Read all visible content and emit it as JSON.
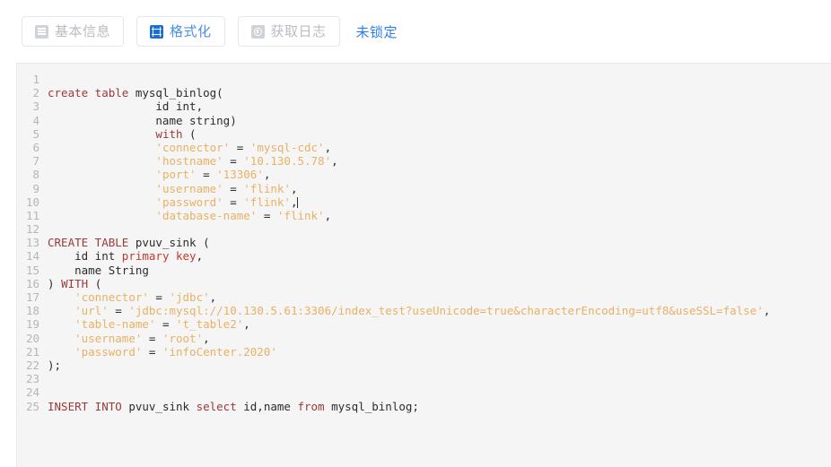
{
  "toolbar": {
    "buttons": [
      {
        "label": "基本信息",
        "icon": "document-icon",
        "state": "inactive"
      },
      {
        "label": "格式化",
        "icon": "grid-table-icon",
        "state": "active"
      },
      {
        "label": "获取日志",
        "icon": "log-clock-icon",
        "state": "inactive"
      }
    ],
    "lock_link": "未锁定"
  },
  "colors": {
    "accent_blue": "#2a7ef0",
    "active_text": "#4a90e8",
    "inactive_text": "#b9bcc2",
    "editor_bg": "#f5f5f5",
    "line_number": "#b6b6b6",
    "keyword": "#9b3a38",
    "keyword_alt": "#c0392b",
    "string": "#e8b164",
    "plain": "#2b2b2b"
  },
  "editor": {
    "language": "sql",
    "line_count": 25,
    "caret_line": 10,
    "lines": [
      {
        "n": "1",
        "tokens": []
      },
      {
        "n": "2",
        "tokens": [
          {
            "t": "create table ",
            "c": "kw"
          },
          {
            "t": "mysql_binlog(",
            "c": "pln"
          }
        ]
      },
      {
        "n": "3",
        "tokens": [
          {
            "t": "                id int,",
            "c": "pln"
          }
        ]
      },
      {
        "n": "4",
        "tokens": [
          {
            "t": "                name string)",
            "c": "pln"
          }
        ]
      },
      {
        "n": "5",
        "tokens": [
          {
            "t": "                ",
            "c": "pln"
          },
          {
            "t": "with",
            "c": "kw"
          },
          {
            "t": " (",
            "c": "pln"
          }
        ]
      },
      {
        "n": "6",
        "tokens": [
          {
            "t": "                ",
            "c": "pln"
          },
          {
            "t": "'connector'",
            "c": "str"
          },
          {
            "t": " = ",
            "c": "pln"
          },
          {
            "t": "'mysql-cdc'",
            "c": "str"
          },
          {
            "t": ",",
            "c": "pln"
          }
        ]
      },
      {
        "n": "7",
        "tokens": [
          {
            "t": "                ",
            "c": "pln"
          },
          {
            "t": "'hostname'",
            "c": "str"
          },
          {
            "t": " = ",
            "c": "pln"
          },
          {
            "t": "'10.130.5.78'",
            "c": "str"
          },
          {
            "t": ",",
            "c": "pln"
          }
        ]
      },
      {
        "n": "8",
        "tokens": [
          {
            "t": "                ",
            "c": "pln"
          },
          {
            "t": "'port'",
            "c": "str"
          },
          {
            "t": " = ",
            "c": "pln"
          },
          {
            "t": "'13306'",
            "c": "str"
          },
          {
            "t": ",",
            "c": "pln"
          }
        ]
      },
      {
        "n": "9",
        "tokens": [
          {
            "t": "                ",
            "c": "pln"
          },
          {
            "t": "'username'",
            "c": "str"
          },
          {
            "t": " = ",
            "c": "pln"
          },
          {
            "t": "'flink'",
            "c": "str"
          },
          {
            "t": ",",
            "c": "pln"
          }
        ]
      },
      {
        "n": "10",
        "tokens": [
          {
            "t": "                ",
            "c": "pln"
          },
          {
            "t": "'password'",
            "c": "str"
          },
          {
            "t": " = ",
            "c": "pln"
          },
          {
            "t": "'flink'",
            "c": "str"
          },
          {
            "t": ",",
            "c": "pln"
          }
        ],
        "caret": true
      },
      {
        "n": "11",
        "tokens": [
          {
            "t": "                ",
            "c": "pln"
          },
          {
            "t": "'database-name'",
            "c": "str"
          },
          {
            "t": " = ",
            "c": "pln"
          },
          {
            "t": "'flink'",
            "c": "str"
          },
          {
            "t": ",",
            "c": "pln"
          }
        ]
      },
      {
        "n": "12",
        "tokens": []
      },
      {
        "n": "13",
        "tokens": [
          {
            "t": "CREATE TABLE ",
            "c": "kw"
          },
          {
            "t": "pvuv_sink (",
            "c": "pln"
          }
        ]
      },
      {
        "n": "14",
        "tokens": [
          {
            "t": "    id int ",
            "c": "pln"
          },
          {
            "t": "primary key",
            "c": "kw2"
          },
          {
            "t": ",",
            "c": "pln"
          }
        ]
      },
      {
        "n": "15",
        "tokens": [
          {
            "t": "    name String",
            "c": "pln"
          }
        ]
      },
      {
        "n": "16",
        "tokens": [
          {
            "t": ") ",
            "c": "pln"
          },
          {
            "t": "WITH",
            "c": "kw"
          },
          {
            "t": " (",
            "c": "pln"
          }
        ]
      },
      {
        "n": "17",
        "tokens": [
          {
            "t": "    ",
            "c": "pln"
          },
          {
            "t": "'connector'",
            "c": "str"
          },
          {
            "t": " = ",
            "c": "pln"
          },
          {
            "t": "'jdbc'",
            "c": "str"
          },
          {
            "t": ",",
            "c": "pln"
          }
        ]
      },
      {
        "n": "18",
        "tokens": [
          {
            "t": "    ",
            "c": "pln"
          },
          {
            "t": "'url'",
            "c": "str"
          },
          {
            "t": " = ",
            "c": "pln"
          },
          {
            "t": "'jdbc:mysql://10.130.5.61:3306/index_test?useUnicode=true&characterEncoding=utf8&useSSL=false'",
            "c": "str"
          },
          {
            "t": ",",
            "c": "pln"
          }
        ]
      },
      {
        "n": "19",
        "tokens": [
          {
            "t": "    ",
            "c": "pln"
          },
          {
            "t": "'table-name'",
            "c": "str"
          },
          {
            "t": " = ",
            "c": "pln"
          },
          {
            "t": "'t_table2'",
            "c": "str"
          },
          {
            "t": ",",
            "c": "pln"
          }
        ]
      },
      {
        "n": "20",
        "tokens": [
          {
            "t": "    ",
            "c": "pln"
          },
          {
            "t": "'username'",
            "c": "str"
          },
          {
            "t": " = ",
            "c": "pln"
          },
          {
            "t": "'root'",
            "c": "str"
          },
          {
            "t": ",",
            "c": "pln"
          }
        ]
      },
      {
        "n": "21",
        "tokens": [
          {
            "t": "    ",
            "c": "pln"
          },
          {
            "t": "'password'",
            "c": "str"
          },
          {
            "t": " = ",
            "c": "pln"
          },
          {
            "t": "'infoCenter.2020'",
            "c": "str"
          }
        ]
      },
      {
        "n": "22",
        "tokens": [
          {
            "t": ");",
            "c": "pln"
          }
        ]
      },
      {
        "n": "23",
        "tokens": []
      },
      {
        "n": "24",
        "tokens": []
      },
      {
        "n": "25",
        "tokens": [
          {
            "t": "INSERT INTO ",
            "c": "kw"
          },
          {
            "t": "pvuv_sink ",
            "c": "pln"
          },
          {
            "t": "select",
            "c": "kw"
          },
          {
            "t": " id,name ",
            "c": "pln"
          },
          {
            "t": "from",
            "c": "kw"
          },
          {
            "t": " mysql_binlog;",
            "c": "pln"
          }
        ]
      }
    ]
  }
}
